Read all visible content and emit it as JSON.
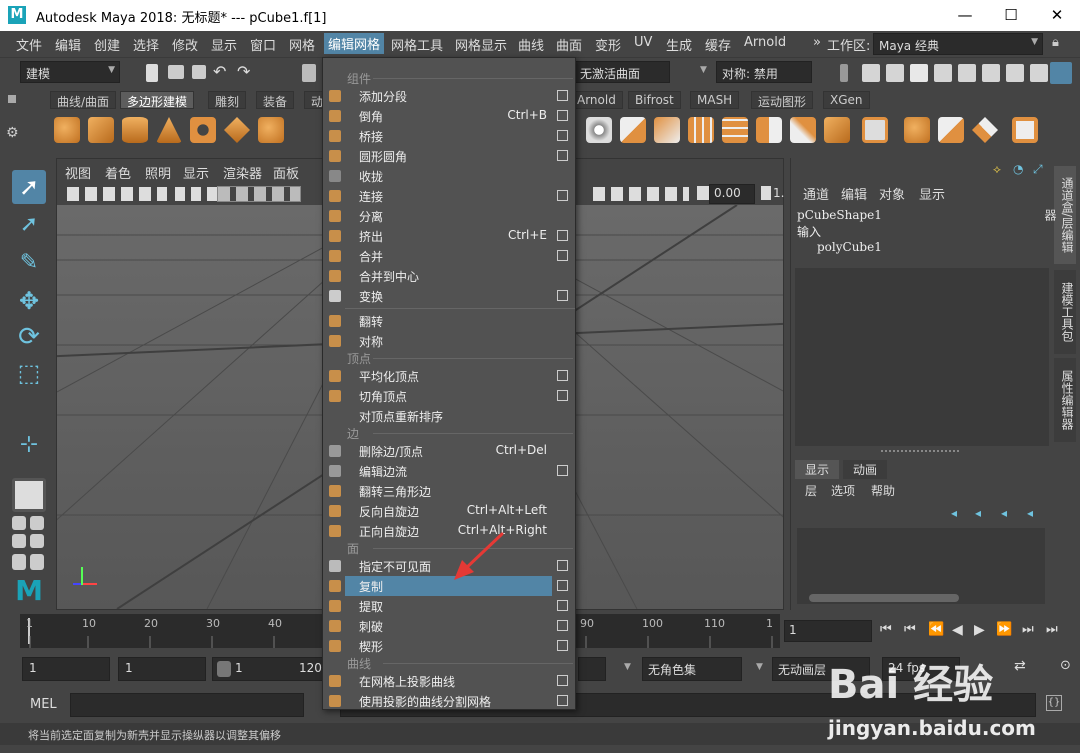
{
  "window": {
    "title": "Autodesk Maya 2018: 无标题*   ---   pCube1.f[1]",
    "logo_letter": "M",
    "minimize": "—",
    "maximize": "☐",
    "close": "✕"
  },
  "menubar": {
    "items": [
      "文件",
      "编辑",
      "创建",
      "选择",
      "修改",
      "显示",
      "窗口",
      "网格",
      "编辑网格",
      "网格工具",
      "网格显示",
      "曲线",
      "曲面",
      "变形",
      "UV",
      "生成",
      "缓存",
      "Arnold"
    ],
    "workspace_label": "工作区:",
    "workspace_value": "Maya 经典",
    "more": "»"
  },
  "statusline": {
    "mode": "建模",
    "live_surface": "无激活曲面",
    "symmetry": "对称: 禁用"
  },
  "shelf": {
    "tabs": [
      "曲线/曲面",
      "多边形建模",
      "雕刻",
      "装备",
      "动",
      "Arnold",
      "Bifrost",
      "MASH",
      "运动图形",
      "XGen"
    ]
  },
  "viewport": {
    "menu": [
      "视图",
      "着色",
      "照明",
      "显示",
      "渲染器",
      "面板"
    ],
    "exposure": "0.00",
    "gamma": "1."
  },
  "channelbox": {
    "menu": [
      "通道",
      "编辑",
      "对象",
      "显示"
    ],
    "shape": "pCubeShape1",
    "inputs_label": "输入",
    "input_node": "polyCube1",
    "layer_tabs": [
      "显示",
      "动画"
    ],
    "layer_menu": [
      "层",
      "选项",
      "帮助"
    ]
  },
  "sidetabs": [
    "通道盒/层编辑器",
    "建模工具包",
    "属性编辑器"
  ],
  "timeslider": {
    "ticks": [
      "1",
      "10",
      "20",
      "30",
      "40",
      "90",
      "100",
      "110",
      "1"
    ],
    "current_frame": "1"
  },
  "rangeslider": {
    "start": "1",
    "anim_start": "1",
    "range_start": "1",
    "range_end": "120",
    "char_set": "无角色集",
    "anim_layer": "无动画层",
    "fps": "24 fps"
  },
  "cmdline": {
    "lang": "MEL"
  },
  "helpline": "将当前选定面复制为新壳并显示操纵器以调整其偏移",
  "edit_menu": {
    "sections": {
      "components": "组件",
      "vertex": "顶点",
      "edge": "边",
      "face": "面",
      "curve": "曲线"
    },
    "components": [
      {
        "label": "添加分段",
        "shortcut": "",
        "box": true
      },
      {
        "label": "倒角",
        "shortcut": "Ctrl+B",
        "box": true
      },
      {
        "label": "桥接",
        "shortcut": "",
        "box": true
      },
      {
        "label": "圆形圆角",
        "shortcut": "",
        "box": true
      },
      {
        "label": "收拢",
        "shortcut": "",
        "box": false
      },
      {
        "label": "连接",
        "shortcut": "",
        "box": true
      },
      {
        "label": "分离",
        "shortcut": "",
        "box": false
      },
      {
        "label": "挤出",
        "shortcut": "Ctrl+E",
        "box": true
      },
      {
        "label": "合并",
        "shortcut": "",
        "box": true
      },
      {
        "label": "合并到中心",
        "shortcut": "",
        "box": false
      },
      {
        "label": "变换",
        "shortcut": "",
        "box": true
      }
    ],
    "components2": [
      {
        "label": "翻转",
        "shortcut": "",
        "box": false
      },
      {
        "label": "对称",
        "shortcut": "",
        "box": false
      }
    ],
    "vertex": [
      {
        "label": "平均化顶点",
        "shortcut": "",
        "box": true
      },
      {
        "label": "切角顶点",
        "shortcut": "",
        "box": true
      },
      {
        "label": "对顶点重新排序",
        "shortcut": "",
        "box": false
      }
    ],
    "edge": [
      {
        "label": "删除边/顶点",
        "shortcut": "Ctrl+Del",
        "box": false
      },
      {
        "label": "编辑边流",
        "shortcut": "",
        "box": true
      },
      {
        "label": "翻转三角形边",
        "shortcut": "",
        "box": false
      },
      {
        "label": "反向自旋边",
        "shortcut": "Ctrl+Alt+Left",
        "box": false
      },
      {
        "label": "正向自旋边",
        "shortcut": "Ctrl+Alt+Right",
        "box": false
      }
    ],
    "face": [
      {
        "label": "指定不可见面",
        "shortcut": "",
        "box": true
      },
      {
        "label": "复制",
        "shortcut": "",
        "box": true,
        "highlighted": true
      },
      {
        "label": "提取",
        "shortcut": "",
        "box": true
      },
      {
        "label": "刺破",
        "shortcut": "",
        "box": true
      },
      {
        "label": "楔形",
        "shortcut": "",
        "box": true
      }
    ],
    "curve": [
      {
        "label": "在网格上投影曲线",
        "shortcut": "",
        "box": true
      },
      {
        "label": "使用投影的曲线分割网格",
        "shortcut": "",
        "box": true
      }
    ]
  },
  "watermark": {
    "logo": "Bai 经验",
    "url": "jingyan.baidu.com"
  },
  "colors": {
    "highlight": "#5285a6",
    "arrow": "#e53935",
    "panel": "#444444",
    "menu_bg": "#525252"
  }
}
